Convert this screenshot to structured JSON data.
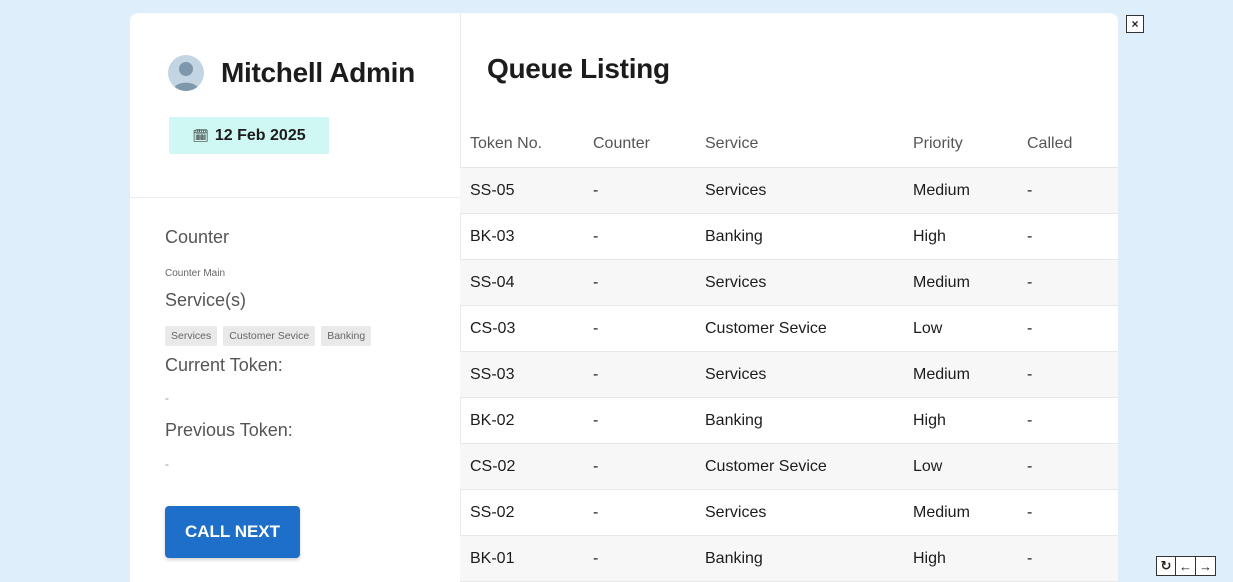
{
  "user": {
    "name": "Mitchell Admin",
    "date": "12 Feb 2025",
    "date_icon": "calendar-icon"
  },
  "counter": {
    "counter_label": "Counter",
    "counter_value": "Counter Main",
    "services_label": "Service(s)",
    "services": [
      "Services",
      "Customer Sevice",
      "Banking"
    ],
    "current_token_label": "Current Token:",
    "current_token_value": "-",
    "previous_token_label": "Previous Token:",
    "previous_token_value": "-",
    "call_next_label": "CALL NEXT"
  },
  "queue": {
    "title": "Queue Listing",
    "columns": [
      "Token No.",
      "Counter",
      "Service",
      "Priority",
      "Called"
    ],
    "rows": [
      [
        "SS-05",
        "-",
        "Services",
        "Medium",
        "-"
      ],
      [
        "BK-03",
        "-",
        "Banking",
        "High",
        "-"
      ],
      [
        "SS-04",
        "-",
        "Services",
        "Medium",
        "-"
      ],
      [
        "CS-03",
        "-",
        "Customer Sevice",
        "Low",
        "-"
      ],
      [
        "SS-03",
        "-",
        "Services",
        "Medium",
        "-"
      ],
      [
        "BK-02",
        "-",
        "Banking",
        "High",
        "-"
      ],
      [
        "CS-02",
        "-",
        "Customer Sevice",
        "Low",
        "-"
      ],
      [
        "SS-02",
        "-",
        "Services",
        "Medium",
        "-"
      ],
      [
        "BK-01",
        "-",
        "Banking",
        "High",
        "-"
      ]
    ]
  },
  "controls": {
    "close_glyph": "×",
    "refresh_glyph": "↻",
    "prev_glyph": "←",
    "next_glyph": "→"
  },
  "colors": {
    "page_bg": "#dfeefb",
    "accent": "#1d6fc9",
    "date_badge": "#cff7f4"
  }
}
